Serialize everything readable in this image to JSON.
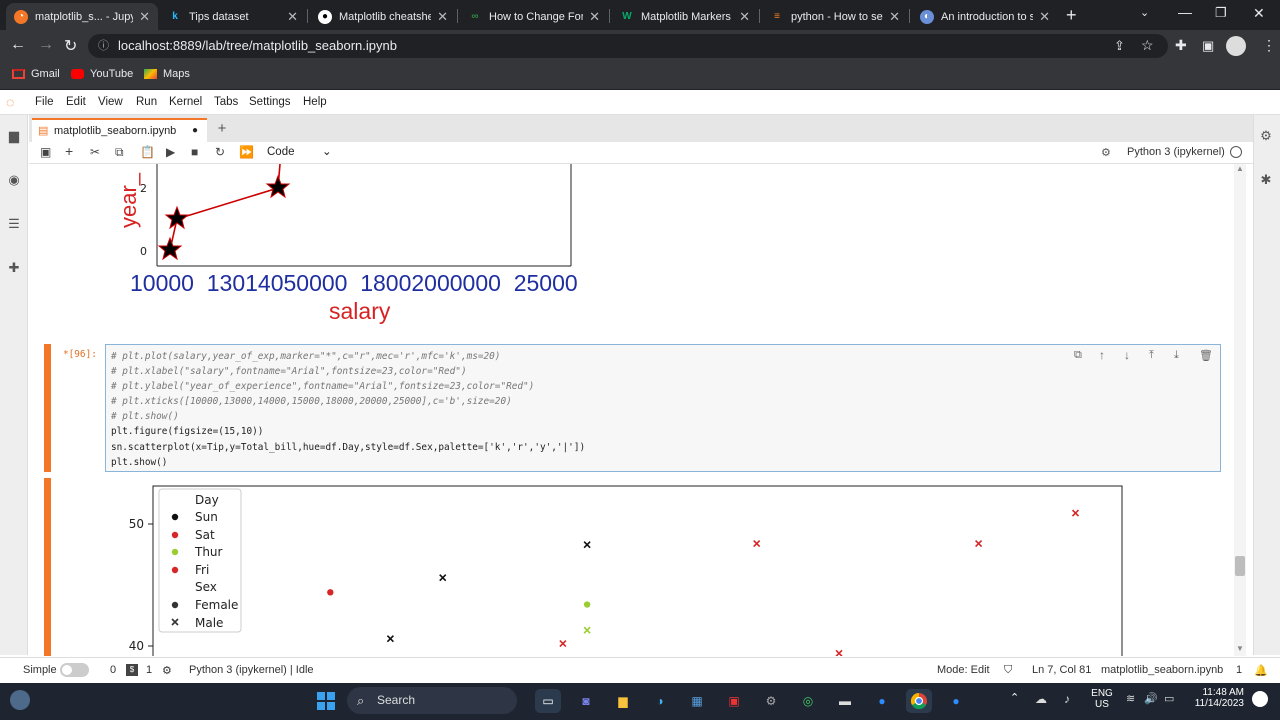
{
  "browser": {
    "tabs": [
      {
        "title": "matplotlib_s... - Jupy",
        "icon": "jupyter-icon"
      },
      {
        "title": "Tips dataset",
        "icon": "kaggle-icon"
      },
      {
        "title": "Matplotlib cheatshee",
        "icon": "github-icon"
      },
      {
        "title": "How to Change Font",
        "icon": "gfg-icon"
      },
      {
        "title": "Matplotlib Markers",
        "icon": "w3schools-icon"
      },
      {
        "title": "python - How to set",
        "icon": "stackoverflow-icon"
      },
      {
        "title": "An introduction to se",
        "icon": "globe-icon"
      }
    ],
    "url": "localhost:8889/lab/tree/matplotlib_seaborn.ipynb",
    "bookmarks": [
      "Gmail",
      "YouTube",
      "Maps"
    ]
  },
  "jupyter": {
    "menu": [
      "File",
      "Edit",
      "View",
      "Run",
      "Kernel",
      "Tabs",
      "Settings",
      "Help"
    ],
    "notebook_tab": "matplotlib_seaborn.ipynb",
    "cell_type": "Code",
    "kernel": "Python 3 (ipykernel)"
  },
  "upper_plot": {
    "ylabel": "year_",
    "yticks": [
      "2",
      "0"
    ],
    "xticks": [
      "10000",
      "13000",
      "14000",
      "15000",
      "18000",
      "20000",
      "25000"
    ],
    "xtick_text": "10000  13014050000  18002000000  25000",
    "xlabel": "salary"
  },
  "cell": {
    "prompt": "*[96]:",
    "lines": [
      "# plt.plot(salary,year_of_exp,marker=\"*\",c=\"r\",mec='r',mfc='k',ms=20)",
      "# plt.xlabel(\"salary\",fontname=\"Arial\",fontsize=23,color=\"Red\")",
      "# plt.ylabel(\"year_of_experience\",fontname=\"Arial\",fontsize=23,color=\"Red\")",
      "# plt.xticks([10000,13000,14000,15000,18000,20000,25000],c='b',size=20)",
      "# plt.show()",
      "plt.figure(figsize=(15,10))",
      "sn.scatterplot(x=Tip,y=Total_bill,hue=df.Day,style=df.Sex,palette=['k','r','y','|'])",
      "plt.show()"
    ]
  },
  "scatter": {
    "yticks": [
      "50",
      "40"
    ],
    "legend": {
      "hue_title": "Day",
      "hue_items": [
        {
          "label": "Sun",
          "color": "#111111"
        },
        {
          "label": "Sat",
          "color": "#d62728"
        },
        {
          "label": "Thur",
          "color": "#9acd32"
        },
        {
          "label": "Fri",
          "color": "#d62728"
        }
      ],
      "style_title": "Sex",
      "style_items": [
        {
          "label": "Female",
          "marker": "circle"
        },
        {
          "label": "Male",
          "marker": "x"
        }
      ]
    }
  },
  "chart_data": {
    "type": "scatter",
    "ylim": [
      38.5,
      52
    ],
    "xlim": [
      0,
      100
    ],
    "yticks": [
      40,
      50
    ],
    "points": [
      {
        "x": 18.3,
        "y": 44.4,
        "color": "#d62728",
        "marker": "circle"
      },
      {
        "x": 24.5,
        "y": 40.6,
        "color": "#111111",
        "marker": "x"
      },
      {
        "x": 29.9,
        "y": 45.6,
        "color": "#111111",
        "marker": "x"
      },
      {
        "x": 42.3,
        "y": 40.2,
        "color": "#d62728",
        "marker": "x"
      },
      {
        "x": 44.8,
        "y": 48.3,
        "color": "#111111",
        "marker": "x"
      },
      {
        "x": 44.8,
        "y": 43.4,
        "color": "#9acd32",
        "marker": "circle"
      },
      {
        "x": 44.8,
        "y": 41.3,
        "color": "#9acd32",
        "marker": "x"
      },
      {
        "x": 62.3,
        "y": 48.4,
        "color": "#d62728",
        "marker": "x"
      },
      {
        "x": 70.8,
        "y": 39.4,
        "color": "#d62728",
        "marker": "x"
      },
      {
        "x": 85.2,
        "y": 48.4,
        "color": "#d62728",
        "marker": "x"
      },
      {
        "x": 95.2,
        "y": 50.9,
        "color": "#d62728",
        "marker": "x"
      }
    ]
  },
  "statusbar": {
    "mode_label": "Simple",
    "count_zero": "0",
    "count_one": "1",
    "kernel_status": "Python 3 (ipykernel) | Idle",
    "edit_mode": "Mode: Edit",
    "position": "Ln 7, Col 81",
    "filename": "matplotlib_seaborn.ipynb",
    "count_right": "1"
  },
  "taskbar": {
    "search": "Search",
    "lang": "ENG",
    "region": "US",
    "time": "11:48 AM",
    "date": "11/14/2023"
  }
}
